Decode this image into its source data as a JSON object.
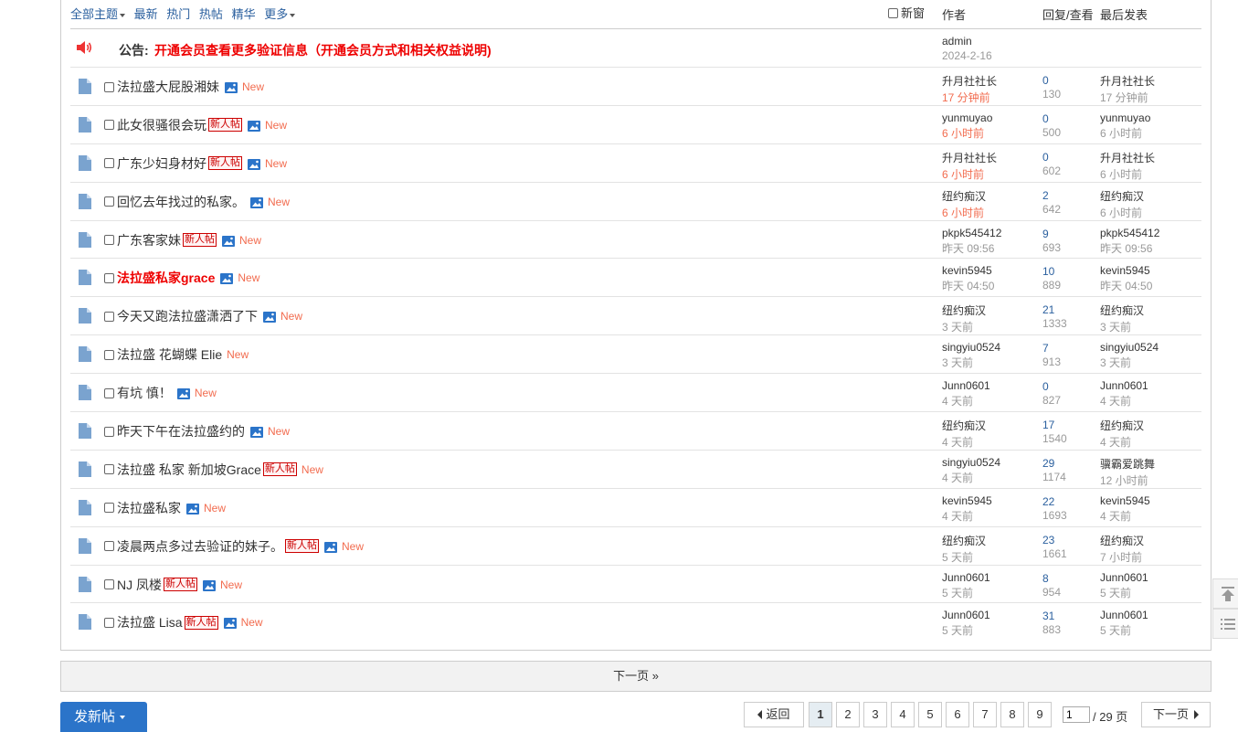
{
  "header": {
    "filters": [
      {
        "label": "全部主题",
        "dropdown": true
      },
      {
        "label": "最新"
      },
      {
        "label": "热门"
      },
      {
        "label": "热帖"
      },
      {
        "label": "精华"
      },
      {
        "label": "更多",
        "dropdown": true
      }
    ],
    "new_window_label": "新窗",
    "col_author": "作者",
    "col_replies": "回复/查看",
    "col_last": "最后发表"
  },
  "announcement": {
    "label": "公告:",
    "text": "开通会员查看更多验证信息（开通会员方式和相关权益说明)",
    "author": "admin",
    "date": "2024-2-16"
  },
  "threads": [
    {
      "title": "法拉盛大屁股湘妹",
      "newbie": false,
      "image": true,
      "highlight": false,
      "author": "升月社社长",
      "time": "17 分钟前",
      "recent": true,
      "replies": "0",
      "views": "130",
      "last_user": "升月社社长",
      "last_time": "17 分钟前"
    },
    {
      "title": "此女很骚很会玩",
      "newbie": true,
      "image": true,
      "highlight": false,
      "author": "yunmuyao",
      "time": "6 小时前",
      "recent": true,
      "replies": "0",
      "views": "500",
      "last_user": "yunmuyao",
      "last_time": "6 小时前"
    },
    {
      "title": "广东少妇身材好",
      "newbie": true,
      "image": true,
      "highlight": false,
      "author": "升月社社长",
      "time": "6 小时前",
      "recent": true,
      "replies": "0",
      "views": "602",
      "last_user": "升月社社长",
      "last_time": "6 小时前"
    },
    {
      "title": "回忆去年找过的私家。",
      "newbie": false,
      "image": true,
      "highlight": false,
      "author": "纽约痴汉",
      "time": "6 小时前",
      "recent": true,
      "replies": "2",
      "views": "642",
      "last_user": "纽约痴汉",
      "last_time": "6 小时前"
    },
    {
      "title": "广东客家妹",
      "newbie": true,
      "image": true,
      "highlight": false,
      "author": "pkpk545412",
      "time": "昨天 09:56",
      "recent": false,
      "replies": "9",
      "views": "693",
      "last_user": "pkpk545412",
      "last_time": "昨天 09:56"
    },
    {
      "title": "法拉盛私家grace",
      "newbie": false,
      "image": true,
      "highlight": true,
      "author": "kevin5945",
      "time": "昨天 04:50",
      "recent": false,
      "replies": "10",
      "views": "889",
      "last_user": "kevin5945",
      "last_time": "昨天 04:50"
    },
    {
      "title": "今天又跑法拉盛潇洒了下",
      "newbie": false,
      "image": true,
      "highlight": false,
      "author": "纽约痴汉",
      "time": "3 天前",
      "recent": false,
      "replies": "21",
      "views": "1333",
      "last_user": "纽约痴汉",
      "last_time": "3 天前"
    },
    {
      "title": "法拉盛 花蝴蝶 Elie",
      "newbie": false,
      "image": false,
      "highlight": false,
      "author": "singyiu0524",
      "time": "3 天前",
      "recent": false,
      "replies": "7",
      "views": "913",
      "last_user": "singyiu0524",
      "last_time": "3 天前"
    },
    {
      "title": "有坑 慎！",
      "newbie": false,
      "image": true,
      "highlight": false,
      "author": "Junn0601",
      "time": "4 天前",
      "recent": false,
      "replies": "0",
      "views": "827",
      "last_user": "Junn0601",
      "last_time": "4 天前"
    },
    {
      "title": "昨天下午在法拉盛约的",
      "newbie": false,
      "image": true,
      "highlight": false,
      "author": "纽约痴汉",
      "time": "4 天前",
      "recent": false,
      "replies": "17",
      "views": "1540",
      "last_user": "纽约痴汉",
      "last_time": "4 天前"
    },
    {
      "title": "法拉盛 私家 新加坡Grace",
      "newbie": true,
      "image": false,
      "highlight": false,
      "author": "singyiu0524",
      "time": "4 天前",
      "recent": false,
      "replies": "29",
      "views": "1174",
      "last_user": "骥霸爱跳舞",
      "last_time": "12 小时前"
    },
    {
      "title": "法拉盛私家",
      "newbie": false,
      "image": true,
      "highlight": false,
      "author": "kevin5945",
      "time": "4 天前",
      "recent": false,
      "replies": "22",
      "views": "1693",
      "last_user": "kevin5945",
      "last_time": "4 天前"
    },
    {
      "title": "凌晨两点多过去验证的妹子。",
      "newbie": true,
      "image": true,
      "highlight": false,
      "author": "纽约痴汉",
      "time": "5 天前",
      "recent": false,
      "replies": "23",
      "views": "1661",
      "last_user": "纽约痴汉",
      "last_time": "7 小时前"
    },
    {
      "title": "NJ 凤楼",
      "newbie": true,
      "image": true,
      "highlight": false,
      "author": "Junn0601",
      "time": "5 天前",
      "recent": false,
      "replies": "8",
      "views": "954",
      "last_user": "Junn0601",
      "last_time": "5 天前"
    },
    {
      "title": "法拉盛 Lisa",
      "newbie": true,
      "image": true,
      "highlight": false,
      "author": "Junn0601",
      "time": "5 天前",
      "recent": false,
      "replies": "31",
      "views": "883",
      "last_user": "Junn0601",
      "last_time": "5 天前"
    }
  ],
  "labels": {
    "newbie_badge": "新人帖",
    "new_tag": "New"
  },
  "next_page_bar": "下一页 »",
  "post_button": "发新帖",
  "pagination": {
    "back": "返回",
    "pages": [
      "1",
      "2",
      "3",
      "4",
      "5",
      "6",
      "7",
      "8",
      "9"
    ],
    "current": "1",
    "input_value": "1",
    "total": "/ 29 页",
    "next": "下一页"
  },
  "colors": {
    "link": "#2a5f9e",
    "highlight": "#e00000",
    "recent_time": "#f26c4f",
    "primary_button": "#2b74c9"
  }
}
